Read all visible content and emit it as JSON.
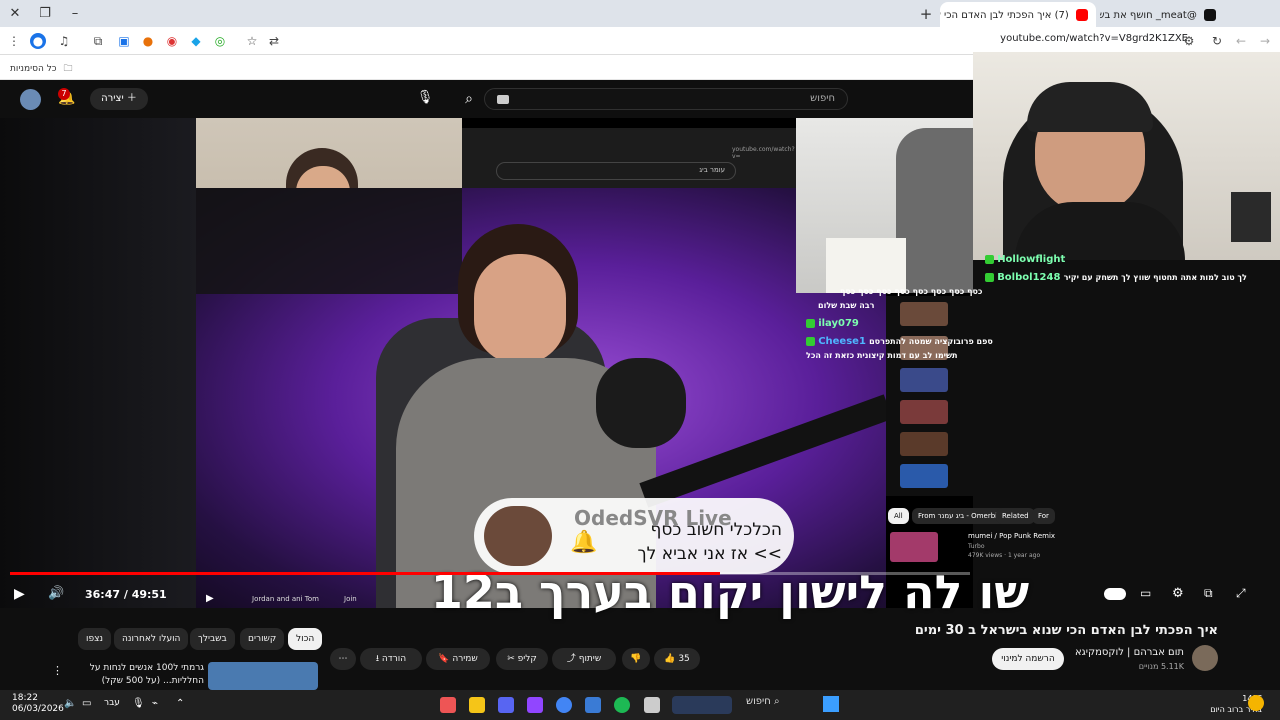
{
  "browser": {
    "tabs": [
      {
        "label": "(7) איך הפכתי לבן האדם הכי שנוא",
        "active": true
      },
      {
        "label": "@meat_ חושף את בשר נא",
        "active": false
      }
    ],
    "url": "youtube.com/watch?v=V8grd2K1ZXE",
    "bookmarks_label": "כל הסימניות",
    "notification_count": "7"
  },
  "youtube": {
    "create_label": "יצירה",
    "search_placeholder": "חיפוש",
    "video_time": "36:47 / 49:51",
    "progress": 0.74,
    "title": "איך הפכתי לבן האדם הכי שנוא בישראל ב 30 ימים",
    "channel": "תום אברהם | לוקסמקיגא",
    "subscribers": "5.11K מנויים",
    "subscribe_label": "הרשמה למינוי",
    "likes": "35",
    "actions": {
      "share": "שיתוף",
      "clip": "קליפ",
      "save": "שמירה",
      "download": "הורדה"
    },
    "chips": [
      "הכול",
      "קשורים",
      "בשבילך",
      "הועלו לאחרונה",
      "נצפו"
    ],
    "recommendation": {
      "title": "גרמתי ל100 אנשים לנחות על החלליות... (על 500 שקל)"
    }
  },
  "overlay": {
    "caption_line1": "הכלכלי חשוב כסף",
    "caption_line2": ">> אז אני אביא לך",
    "streamer": "OdedSVR Live",
    "subtitle_big": "שו לה לישון יקום בערך ב12",
    "in_video": {
      "chip_all": "All",
      "chip_from": "From ביג עמנר - Omerbig",
      "chip_related": "Related",
      "chip_for": "For",
      "ep_title": "mumei / Pop Punk Remix",
      "ep_channel": "Turbo",
      "ep_meta": "479K views · 1 year ago",
      "player_channel": "Jordan and ani Tom",
      "join": "Join",
      "inner_search": "עומר ביג",
      "inner_url": "youtube.com/watch?v="
    },
    "chat": [
      {
        "user": "Hollowflight",
        "text": ""
      },
      {
        "user": "Bolbol1248",
        "text": "לך טוב למות אתה תחטוף שווץ לך תשחק עם יקיר"
      },
      {
        "user": "",
        "text": "כסף כסף כסף כסף כסף כסף כסף כסף"
      },
      {
        "user": "",
        "text": "רבה שבת שלום"
      },
      {
        "user": "ilay079",
        "text": ""
      },
      {
        "user": "Cheese1",
        "text": "ספם פרובוקציה שמטה להתפרסם"
      },
      {
        "user": "",
        "text": "תשימו לב עם דמות קיצונית כזאת זה הכל"
      }
    ]
  },
  "taskbar": {
    "time": "18:22",
    "date": "06/03/2026",
    "lang": "עבר",
    "search_label": "חיפוש",
    "temp": "14°C",
    "weather": "בהיר ברוב היום"
  },
  "colors": {
    "accent": "#ff0000",
    "yt_bg": "#0f0f0f",
    "chip_bg": "#272727",
    "chat_user": "#7dffb0"
  }
}
